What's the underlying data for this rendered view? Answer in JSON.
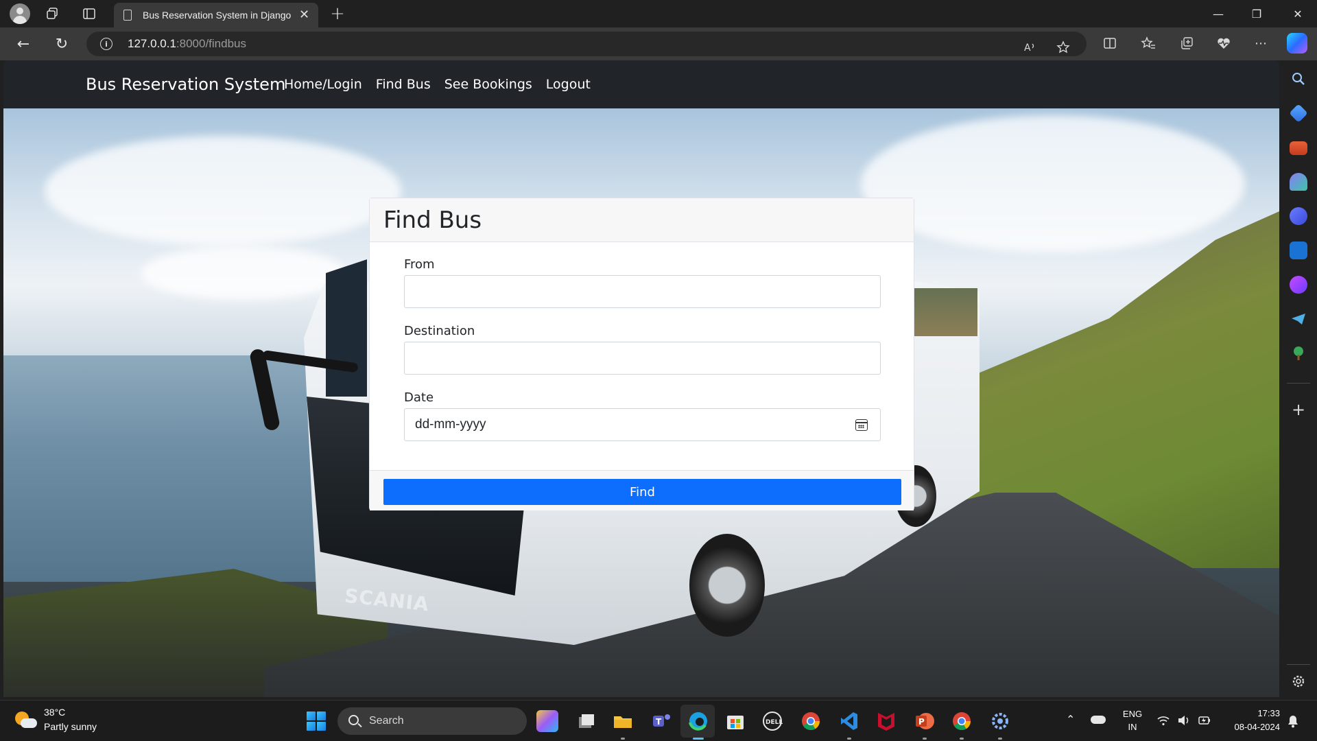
{
  "browser": {
    "tab_title": "Bus Reservation System in Django",
    "tab_close": "✕",
    "new_tab": "+",
    "url_host": "127.0.0.1",
    "url_rest": ":8000/findbus",
    "window_controls": {
      "minimize": "—",
      "maximize": "❐",
      "close": "✕"
    },
    "nav": {
      "back": "←",
      "reload": "↻"
    },
    "toolbar_icons": [
      "read-aloud-icon",
      "favorite-star-icon",
      "split-screen-icon",
      "favorites-icon",
      "collections-icon",
      "browser-essentials-icon",
      "more-icon"
    ]
  },
  "navbar": {
    "brand": "Bus Reservation System",
    "links": [
      "Home/Login",
      "Find Bus",
      "See Bookings",
      "Logout"
    ]
  },
  "form": {
    "title": "Find Bus",
    "from_label": "From",
    "from_value": "",
    "destination_label": "Destination",
    "destination_value": "",
    "date_label": "Date",
    "date_placeholder": "dd-mm-yyyy",
    "submit_label": "Find",
    "button_color": "#0d6efd"
  },
  "hero": {
    "bus_brand": "SCANIA"
  },
  "taskbar": {
    "weather_temp": "38°C",
    "weather_desc": "Partly sunny",
    "search_placeholder": "Search",
    "lang_top": "ENG",
    "lang_bottom": "IN",
    "time": "17:33",
    "date": "08-04-2024",
    "apps": [
      "copilot-icon",
      "task-view-icon",
      "file-explorer-icon",
      "teams-icon",
      "edge-icon",
      "store-icon",
      "dell-icon",
      "chrome-icon",
      "vscode-icon",
      "mcafee-icon",
      "powerpoint-icon",
      "chrome-icon",
      "settings-icon"
    ]
  },
  "sidebar": {
    "icons": [
      "search-icon",
      "shopping-icon",
      "tools-icon",
      "games-icon",
      "office-icon",
      "outlook-icon",
      "designer-icon",
      "telegram-icon",
      "tree-icon",
      "add-icon",
      "settings-icon"
    ]
  }
}
